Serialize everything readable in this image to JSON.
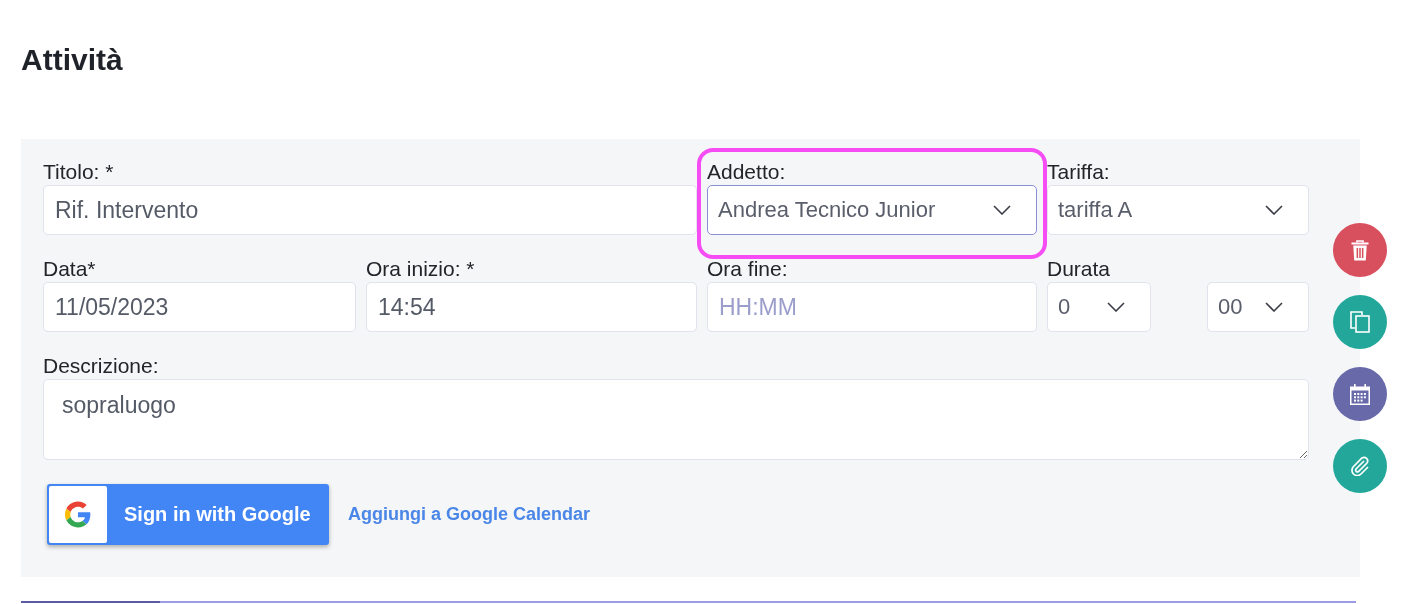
{
  "page": {
    "title": "Attività"
  },
  "form": {
    "rows": [
      {
        "fields": [
          {
            "kind": "text",
            "label": "Titolo: *",
            "value": "Rif. Intervento",
            "focused": false,
            "highlighted": false
          },
          {
            "kind": "select",
            "label": "Addetto:",
            "value": "Andrea Tecnico Junior",
            "focused": true,
            "highlighted": true
          },
          {
            "kind": "select",
            "label": "Tariffa:",
            "value": "tariffa A",
            "focused": false,
            "highlighted": false
          }
        ]
      },
      {
        "fields": [
          {
            "kind": "date",
            "label": "Data*",
            "value": "11/05/2023",
            "focused": false,
            "highlighted": false
          },
          {
            "kind": "time",
            "label": "Ora inizio: *",
            "value": "14:54",
            "focused": false,
            "highlighted": false
          },
          {
            "kind": "time",
            "label": "Ora fine:",
            "placeholder": "HH:MM",
            "focused": false,
            "highlighted": false
          },
          {
            "kind": "duration",
            "label": "Durata",
            "selects": [
              {
                "value": "0"
              },
              {
                "value": "00"
              }
            ],
            "focused": false,
            "highlighted": false
          }
        ]
      },
      {
        "fields": [
          {
            "kind": "textarea",
            "label": "Descrizione:",
            "value": "sopraluogo",
            "focused": false,
            "highlighted": false
          }
        ]
      }
    ],
    "google_button": {
      "label": "Sign in with Google"
    },
    "calendar_link": {
      "label": "Aggiungi a Google Calendar"
    }
  },
  "actions": [
    {
      "kind": "delete",
      "color": "#d8505e"
    },
    {
      "kind": "copy",
      "color": "#22a79a"
    },
    {
      "kind": "calendar",
      "color": "#6869a9"
    },
    {
      "kind": "attach",
      "color": "#22a79a"
    }
  ]
}
